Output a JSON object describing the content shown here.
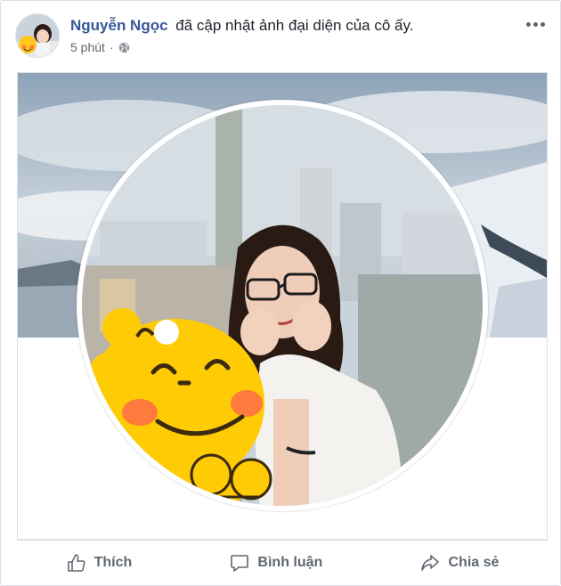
{
  "post": {
    "author_name": "Nguyễn Ngọc",
    "action_text": "đã cập nhật ảnh đại diện của cô ấy.",
    "timestamp": "5 phút",
    "separator": "·",
    "privacy_icon": "globe-icon"
  },
  "actions": {
    "like_label": "Thích",
    "comment_label": "Bình luận",
    "share_label": "Chia sẻ"
  },
  "colors": {
    "author_link": "#365899",
    "secondary_text": "#606770",
    "border": "#dddfe2"
  }
}
